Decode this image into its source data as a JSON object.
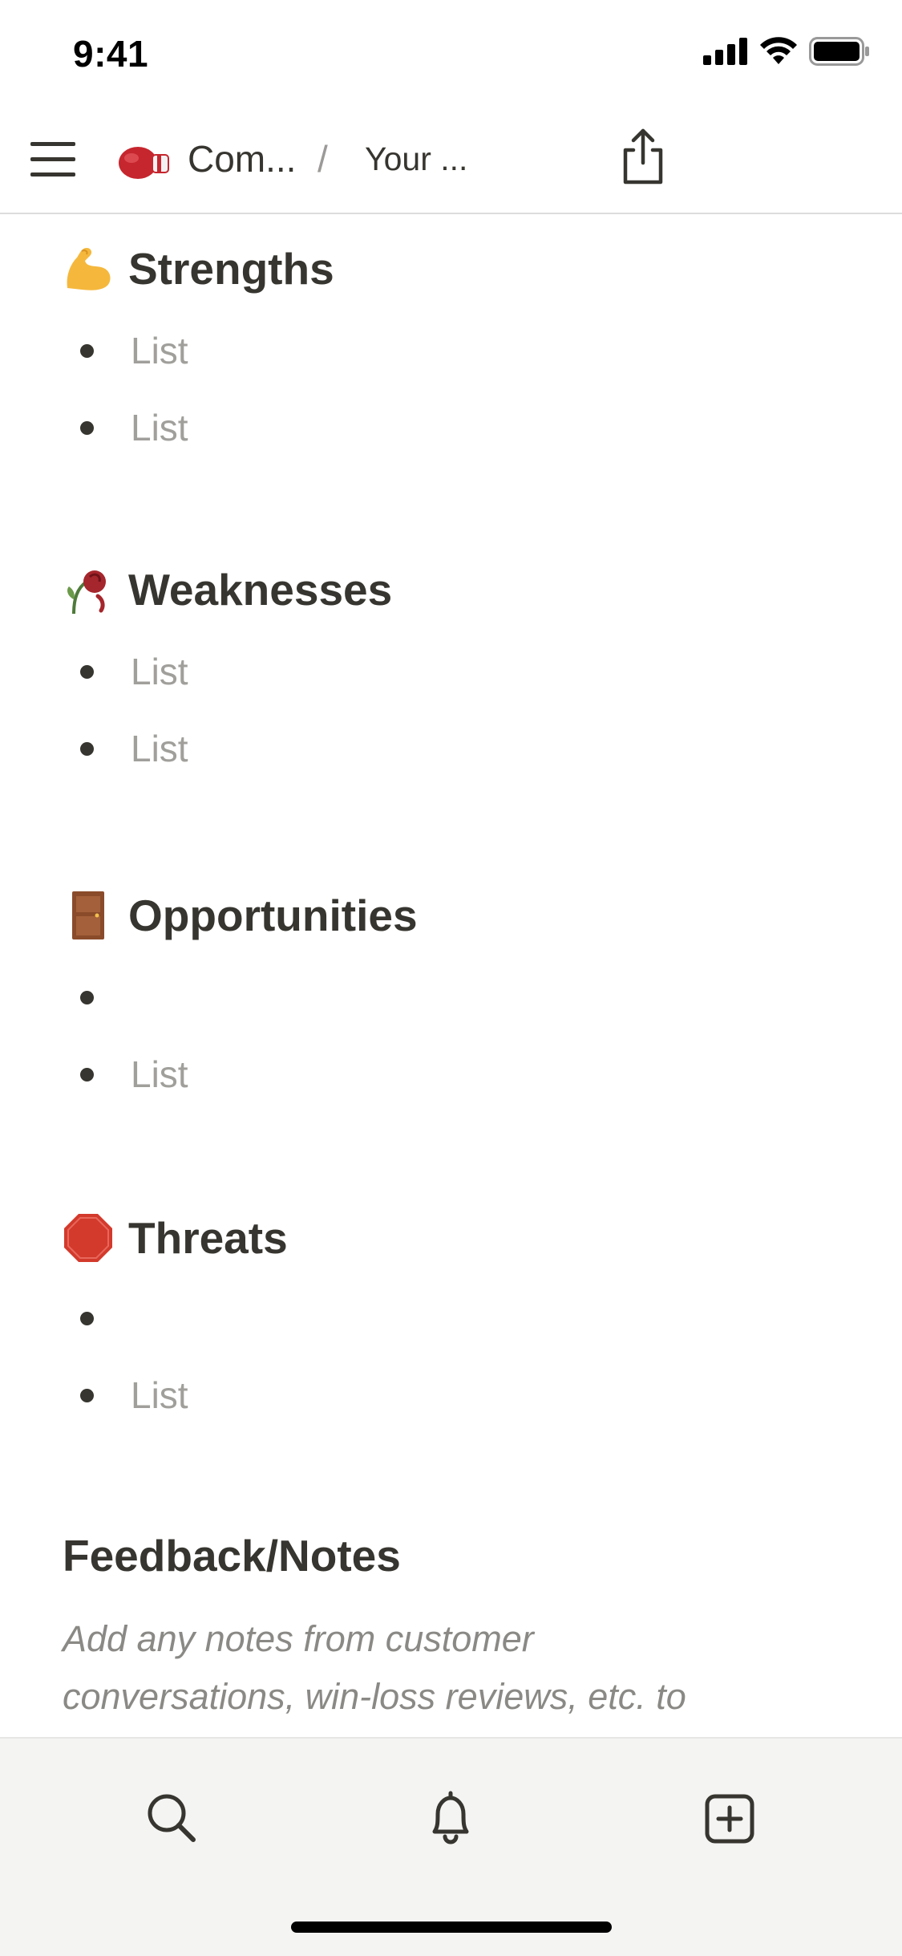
{
  "status_bar": {
    "time": "9:41"
  },
  "nav": {
    "crumb_1": "Com...",
    "separator": "/",
    "crumb_2": "Your ..."
  },
  "sections": [
    {
      "title": "Strengths",
      "icon": "flexed-biceps-icon",
      "items": [
        "List",
        "List"
      ]
    },
    {
      "title": "Weaknesses",
      "icon": "wilted-rose-icon",
      "items": [
        "List",
        "List"
      ]
    },
    {
      "title": "Opportunities",
      "icon": "door-icon",
      "items": [
        "",
        "List"
      ]
    },
    {
      "title": "Threats",
      "icon": "stop-sign-icon",
      "items": [
        "",
        "List"
      ]
    }
  ],
  "feedback": {
    "title": "Feedback/Notes",
    "line_1": "Add any notes from customer",
    "line_2": "conversations, win-loss reviews, etc. to"
  },
  "tab_bar": {
    "icons": [
      "search-icon",
      "bell-icon",
      "add-page-icon"
    ]
  }
}
